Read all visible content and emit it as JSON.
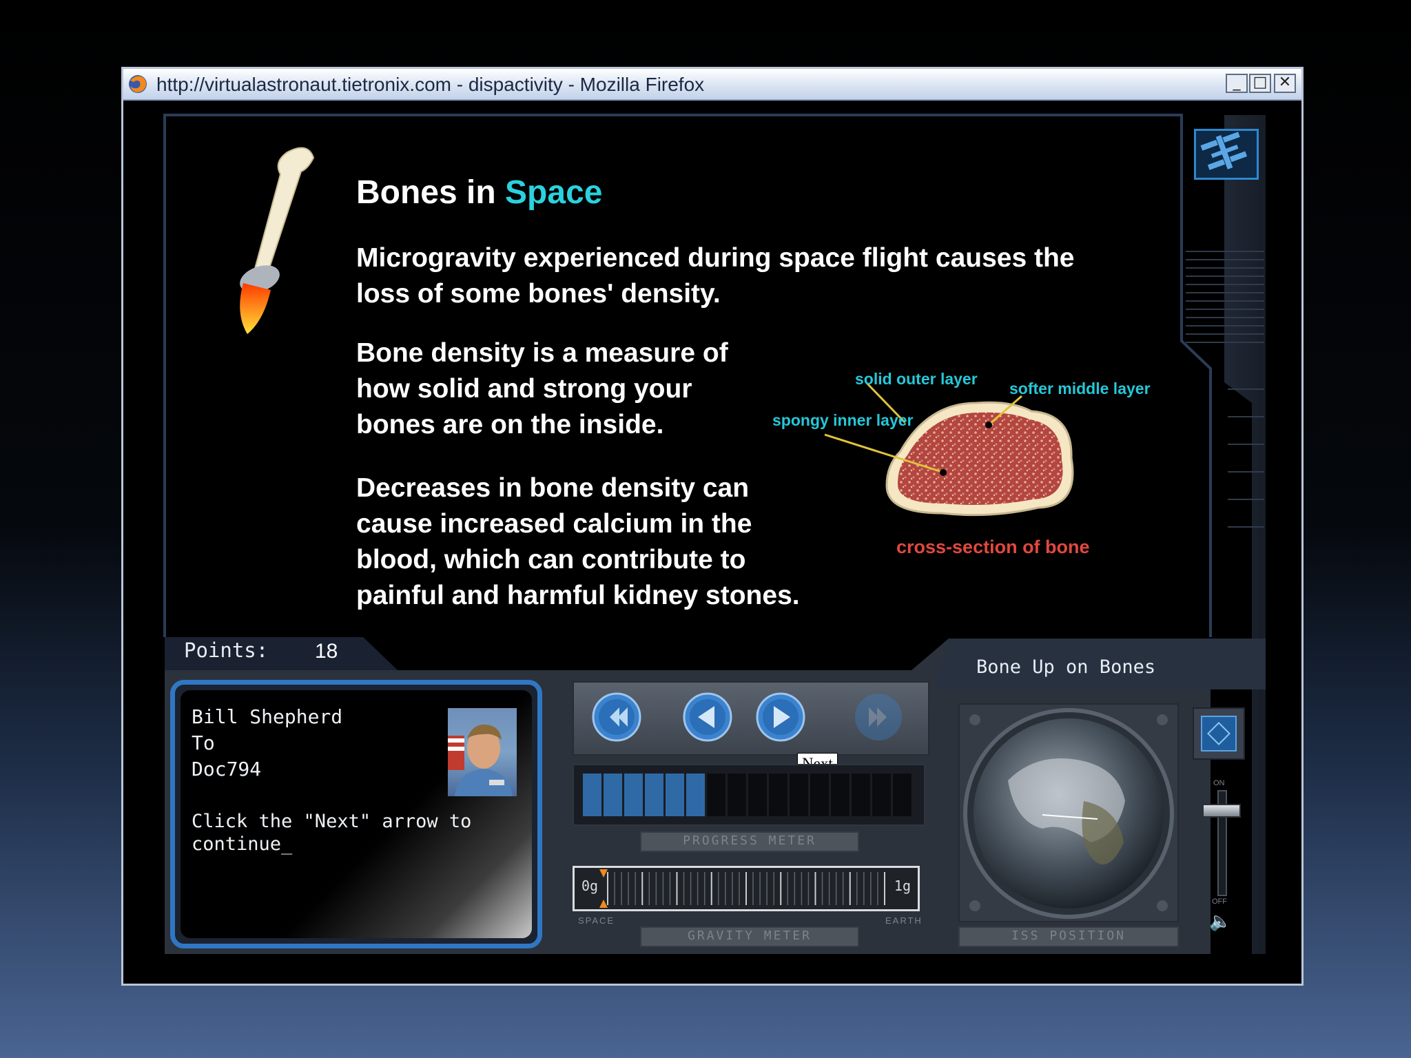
{
  "window": {
    "title": "http://virtualastronaut.tietronix.com - dispactivity - Mozilla Firefox",
    "controls": {
      "minimize": "_",
      "maximize": "□",
      "close": "✕"
    }
  },
  "lesson": {
    "title_part1": "Bones in ",
    "title_part2": "Space",
    "para1_line1": "Microgravity experienced during space flight causes the",
    "para1_line2": "loss of some bones' density.",
    "para2_line1": "Bone density is a measure of",
    "para2_line2": "how solid and strong your",
    "para2_line3": "bones are on the inside.",
    "para3_line1": "Decreases in bone density can",
    "para3_line2": "cause increased calcium in the",
    "para3_line3": "blood, which can contribute to",
    "para3_line4": "painful and harmful kidney stones."
  },
  "diagram": {
    "label_outer": "solid outer layer",
    "label_middle": "softer middle layer",
    "label_inner": "spongy inner layer",
    "caption": "cross-section of bone"
  },
  "points": {
    "label": "Points:",
    "value": "18"
  },
  "activity": {
    "name": "Bone Up on Bones"
  },
  "message": {
    "from": "Bill Shepherd",
    "to_label": "To",
    "recipient": "Doc794",
    "text_line1": "Click the \"Next\" arrow to",
    "text_line2": "continue_"
  },
  "nav": {
    "first_icon": "rewind-icon",
    "prev_icon": "back-arrow-icon",
    "next_icon": "forward-arrow-icon",
    "last_icon": "fast-forward-icon",
    "tooltip": "Next"
  },
  "progress": {
    "label": "PROGRESS METER",
    "filled_segments": 6,
    "total_segments": 16
  },
  "gravity": {
    "label": "GRAVITY METER",
    "min_label": "0g",
    "max_label": "1g",
    "left_caption": "SPACE",
    "right_caption": "EARTH",
    "value_g": 0.0
  },
  "iss": {
    "label": "ISS POSITION"
  },
  "volume": {
    "on_label": "ON",
    "off_label": "OFF",
    "level": 0.85
  },
  "colors": {
    "accent_cyan": "#2ad2df",
    "caption_red": "#e2483e",
    "frame_blue": "#2d6fbd",
    "progress_fill": "#2f6aa6"
  }
}
